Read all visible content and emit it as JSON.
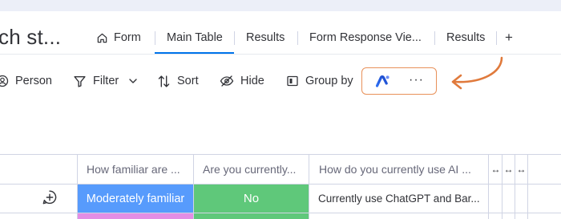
{
  "board": {
    "title": "ch st..."
  },
  "tabs": [
    {
      "label": "Form",
      "icon": "home-icon",
      "active": false
    },
    {
      "label": "Main Table",
      "active": true
    },
    {
      "label": "Results",
      "active": false
    },
    {
      "label": "Form Response Vie...",
      "active": false
    },
    {
      "label": "Results",
      "active": false
    },
    {
      "label": "+",
      "icon": "plus-icon"
    }
  ],
  "toolbar": {
    "person_label": "Person",
    "filter_label": "Filter",
    "sort_label": "Sort",
    "hide_label": "Hide",
    "group_by_label": "Group by",
    "ai_icon": "ai-assistant-icon",
    "more_label": "···"
  },
  "table": {
    "columns": [
      "How familiar are ...",
      "Are you currently...",
      "How do you currently use AI ..."
    ],
    "resize_icon_label": "↔",
    "rows": [
      {
        "familiarity": "Moderately familiar",
        "currently": "No",
        "usage": "Currently use ChatGPT and Bar..."
      }
    ]
  },
  "colors": {
    "accent": "#0073ea",
    "highlight_border": "#e8915a",
    "arrow": "#e07a3c",
    "familiar_blue": "#579bfc",
    "no_green": "#5fc87a",
    "pink": "#e48ee5"
  }
}
